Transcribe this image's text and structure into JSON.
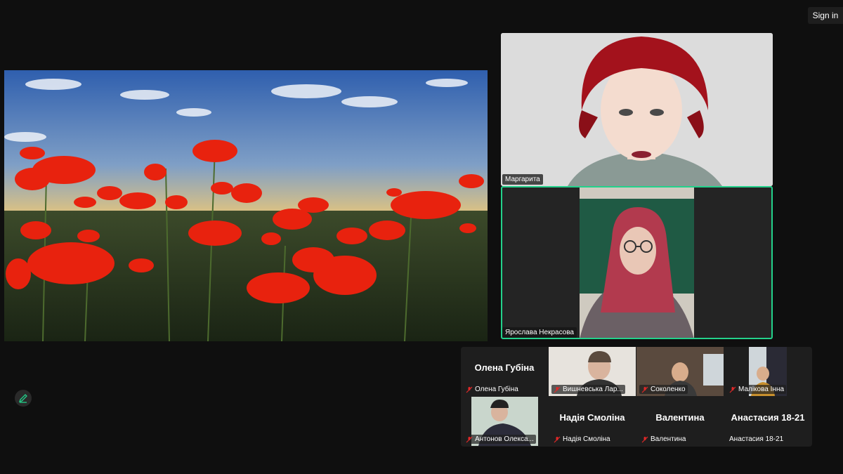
{
  "header": {
    "signin_label": "Sign in"
  },
  "shared_screen": {
    "description_icon": "poppy-field-image"
  },
  "speakers": [
    {
      "name": "Маргарита"
    },
    {
      "name": "Ярослава Некрасова"
    }
  ],
  "gallery": [
    {
      "big_name": "Олена Губіна",
      "label": "Олена Губіна",
      "video": false
    },
    {
      "big_name": "",
      "label": "Вишневська Лар...",
      "video": true
    },
    {
      "big_name": "",
      "label": "Соколенко",
      "video": true
    },
    {
      "big_name": "",
      "label": "Малікова Інна",
      "video": true
    },
    {
      "big_name": "",
      "label": "Антонов Олекса...",
      "video": true
    },
    {
      "big_name": "Надія Смоліна",
      "label": "Надія Смоліна",
      "video": false
    },
    {
      "big_name": "Валентина",
      "label": "Валентина",
      "video": false
    },
    {
      "big_name": "Анастасия 18-21",
      "label": "Анастасия 18-21",
      "video": false
    }
  ],
  "colors": {
    "active_speaker": "#23d18b",
    "muted": "#e02828"
  }
}
